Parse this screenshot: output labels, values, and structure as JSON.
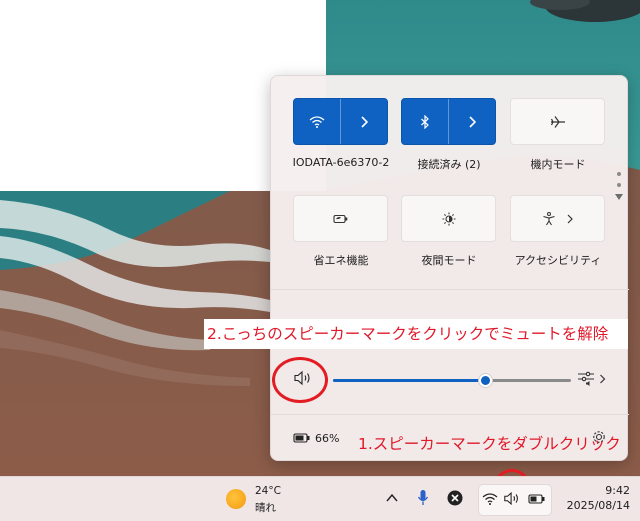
{
  "quick_settings": {
    "tiles": [
      {
        "label": "IODATA-6e6370-2",
        "icon": "wifi-icon",
        "active": true,
        "has_arrow": true
      },
      {
        "label": "接続済み (2)",
        "icon": "bluetooth-icon",
        "active": true,
        "has_arrow": true
      },
      {
        "label": "機内モード",
        "icon": "airplane-icon",
        "active": false,
        "has_arrow": false
      },
      {
        "label": "省エネ機能",
        "icon": "battery-saver-icon",
        "active": false,
        "has_arrow": false
      },
      {
        "label": "夜間モード",
        "icon": "brightness-icon",
        "active": false,
        "has_arrow": false
      },
      {
        "label": "アクセシビリティ",
        "icon": "accessibility-icon",
        "active": false,
        "has_arrow": true
      }
    ],
    "volume": {
      "level_fraction": 0.64,
      "icon": "speaker-icon"
    },
    "battery": {
      "percent_text": "66%",
      "icon": "battery-icon"
    },
    "settings_icon": "gear-icon"
  },
  "annotations": {
    "step1": "1.スピーカーマークをダブルクリック",
    "step2": "2.こっちのスピーカーマークをクリックでミュートを解除"
  },
  "taskbar": {
    "weather": {
      "temp": "24°C",
      "condition": "晴れ",
      "icon": "sun-icon"
    },
    "tray_icons": [
      "chevron-up-icon",
      "microphone-icon",
      "close-circle-icon",
      "wifi-icon",
      "speaker-icon",
      "battery-icon"
    ],
    "clock": {
      "time": "9:42",
      "date": "2025/08/14"
    }
  },
  "colors": {
    "accent": "#0f62c2",
    "annotation_red": "#e0182a",
    "flyout_bg": "#f6eeee",
    "taskbar_bg": "#f0e6e6"
  }
}
